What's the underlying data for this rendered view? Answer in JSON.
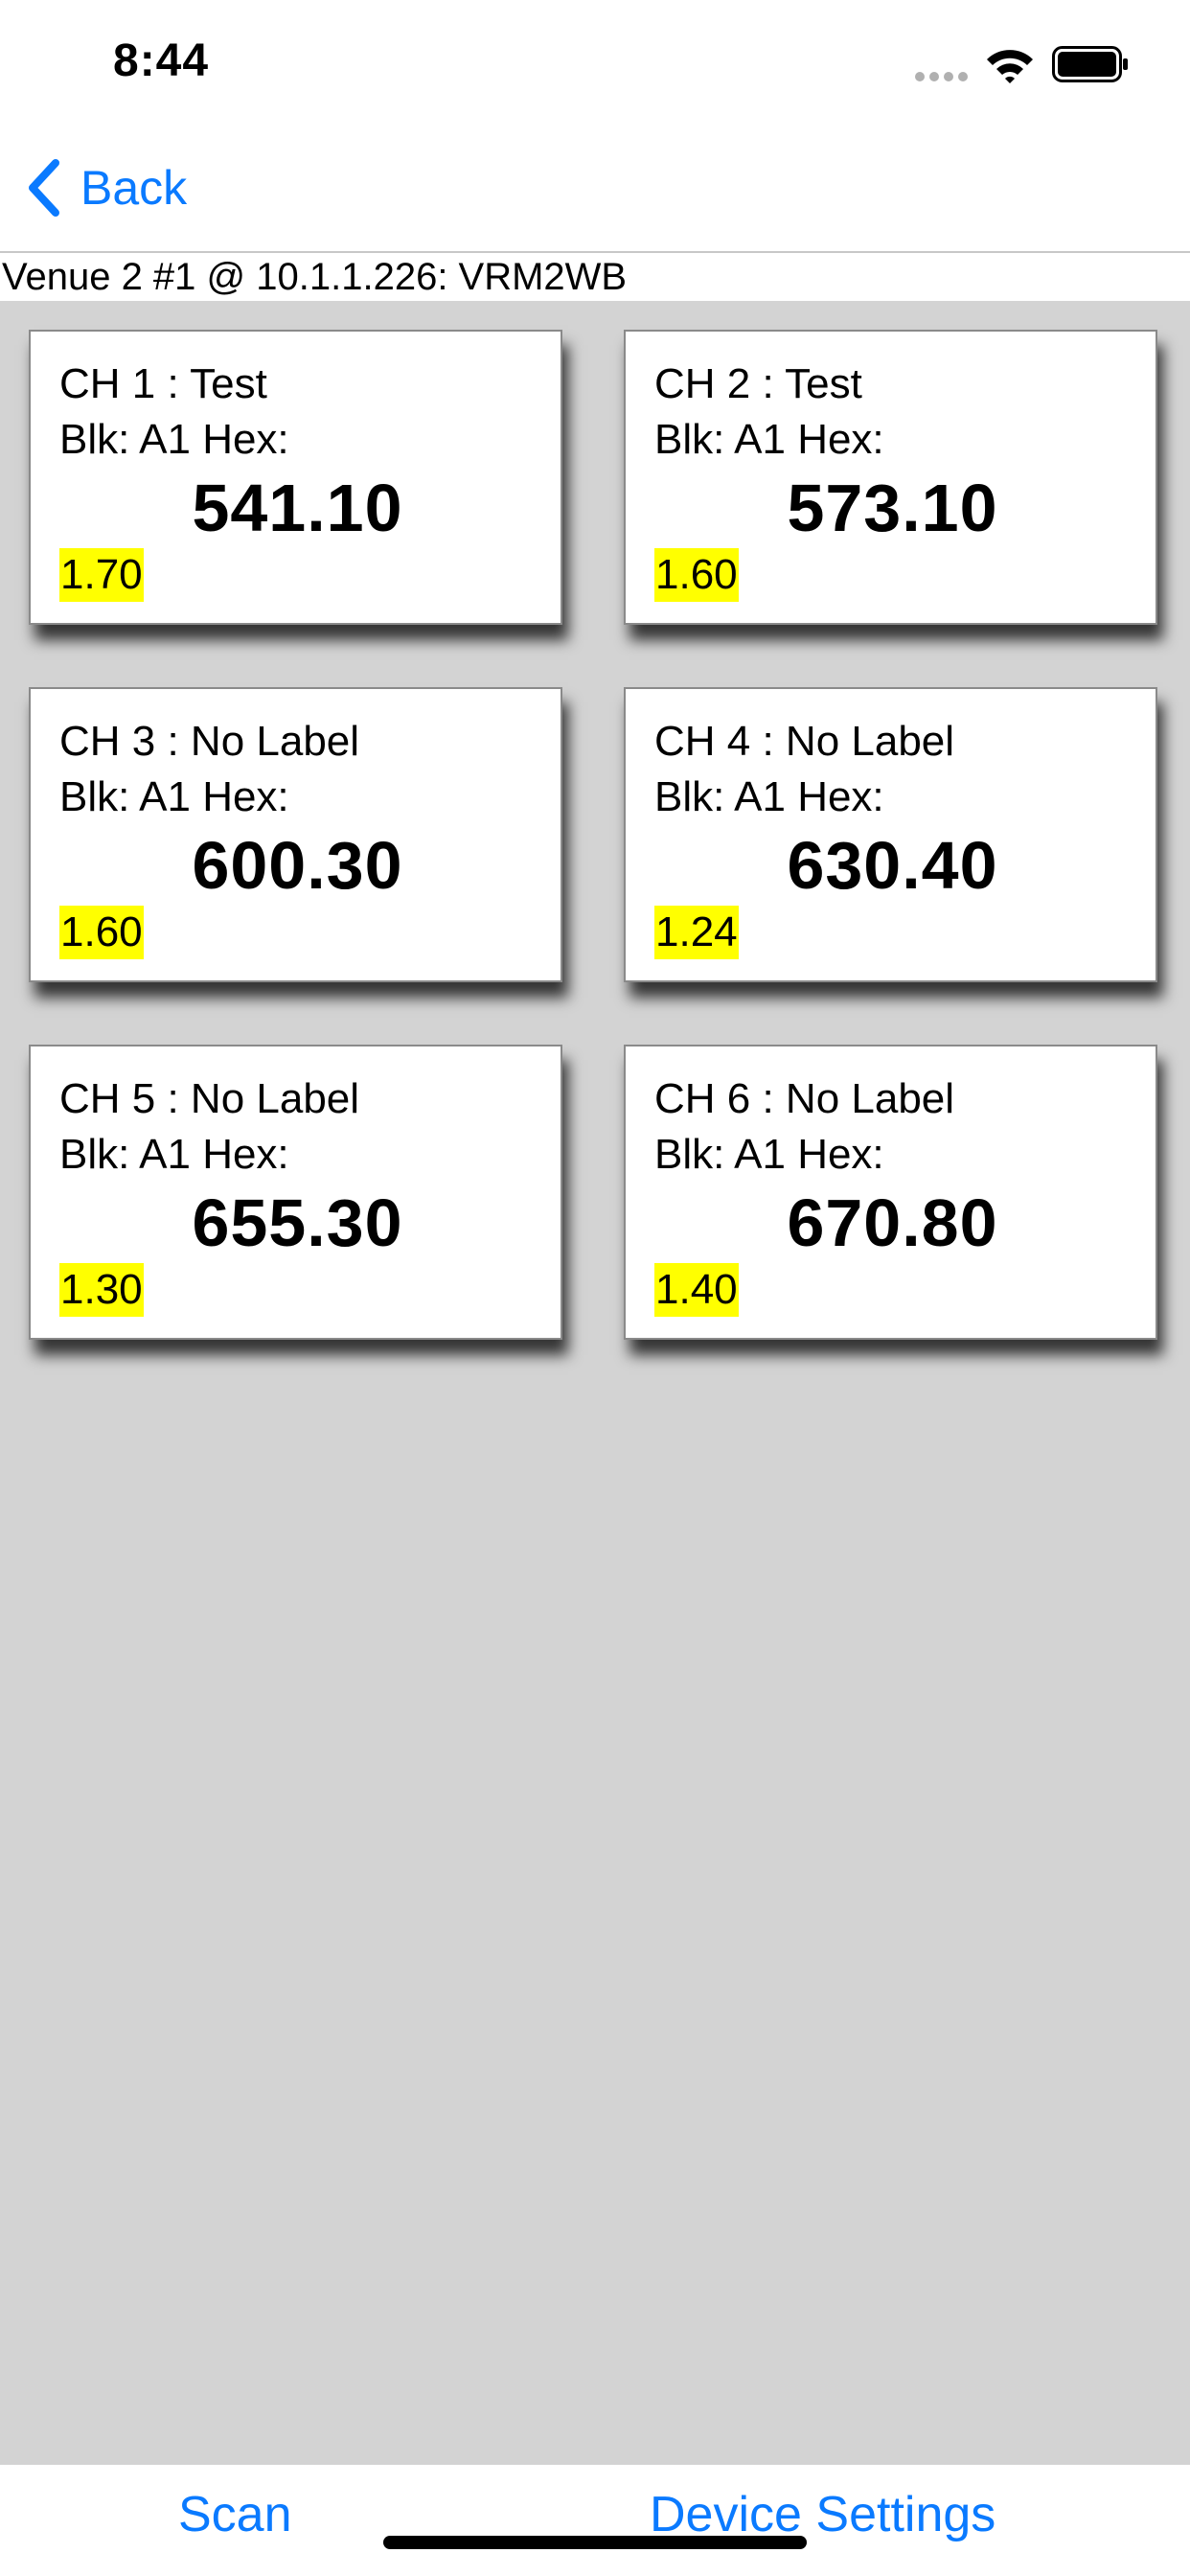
{
  "status_bar": {
    "time": "8:44"
  },
  "nav": {
    "back_label": "Back"
  },
  "device": {
    "header": "Venue 2 #1 @ 10.1.1.226: VRM2WB"
  },
  "channels": [
    {
      "title": "CH 1 : Test",
      "sub": "Blk: A1 Hex:",
      "freq": "541.10",
      "level": "1.70"
    },
    {
      "title": "CH 2 : Test",
      "sub": "Blk: A1 Hex:",
      "freq": "573.10",
      "level": "1.60"
    },
    {
      "title": "CH 3 : No Label",
      "sub": "Blk: A1 Hex:",
      "freq": "600.30",
      "level": "1.60"
    },
    {
      "title": "CH 4 : No Label",
      "sub": "Blk: A1 Hex:",
      "freq": "630.40",
      "level": "1.24"
    },
    {
      "title": "CH 5 : No Label",
      "sub": "Blk: A1 Hex:",
      "freq": "655.30",
      "level": "1.30"
    },
    {
      "title": "CH 6 : No Label",
      "sub": "Blk: A1 Hex:",
      "freq": "670.80",
      "level": "1.40"
    }
  ],
  "toolbar": {
    "scan_label": "Scan",
    "settings_label": "Device Settings"
  },
  "colors": {
    "accent": "#0a7aff",
    "level_highlight": "#ffff00",
    "background": "#d3d3d3"
  }
}
